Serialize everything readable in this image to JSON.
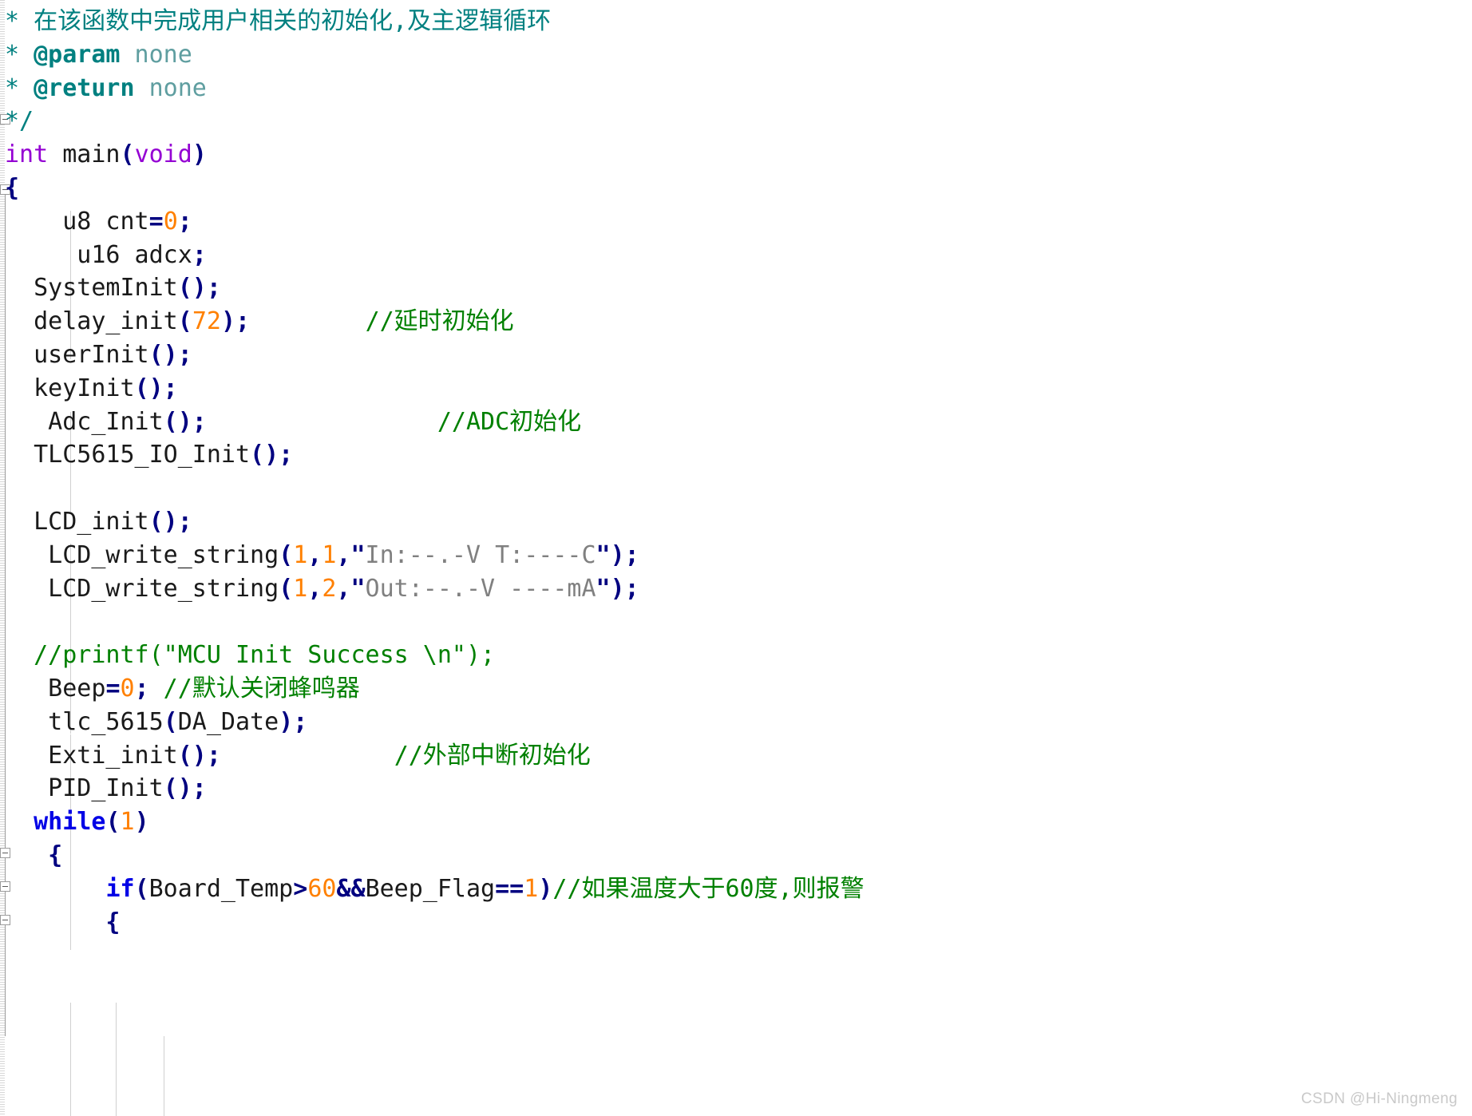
{
  "editor": {
    "language": "c",
    "watermark": "CSDN @Hi-Ningmeng",
    "colors": {
      "background": "#ffffff",
      "doc_comment": "#008080",
      "keyword_type": "#9400d3",
      "keyword_control": "#0000e6",
      "punctuation": "#000080",
      "number": "#ff8000",
      "identifier": "#1a1a1a",
      "line_comment": "#008000",
      "string": "#808080",
      "indent_guide": "#d0d0d0",
      "fold_marker": "#9a9a9a"
    }
  },
  "code": {
    "lines": [
      {
        "id": "l1",
        "tokens": [
          {
            "t": "doc",
            "v": "* "
          },
          {
            "t": "doc",
            "v": "在该函数中完成用户相关的初始化,及主逻辑循环"
          }
        ]
      },
      {
        "id": "l2",
        "tokens": [
          {
            "t": "doc",
            "v": "* "
          },
          {
            "t": "doctag",
            "v": "@param"
          },
          {
            "t": "docval",
            "v": " none"
          }
        ]
      },
      {
        "id": "l3",
        "tokens": [
          {
            "t": "doc",
            "v": "* "
          },
          {
            "t": "doctag",
            "v": "@return"
          },
          {
            "t": "docval",
            "v": " none"
          }
        ]
      },
      {
        "id": "l4",
        "tokens": [
          {
            "t": "doc",
            "v": "*/"
          }
        ]
      },
      {
        "id": "l5",
        "tokens": [
          {
            "t": "kw",
            "v": "int"
          },
          {
            "t": "id",
            "v": " main"
          },
          {
            "t": "punct",
            "v": "("
          },
          {
            "t": "kw",
            "v": "void"
          },
          {
            "t": "punct",
            "v": ")"
          }
        ]
      },
      {
        "id": "l6",
        "tokens": [
          {
            "t": "punct",
            "v": "{"
          }
        ]
      },
      {
        "id": "l7",
        "tokens": [
          {
            "t": "id",
            "v": "    u8 cnt"
          },
          {
            "t": "op",
            "v": "="
          },
          {
            "t": "num",
            "v": "0"
          },
          {
            "t": "punct",
            "v": ";"
          }
        ]
      },
      {
        "id": "l8",
        "tokens": [
          {
            "t": "id",
            "v": "     u16 adcx"
          },
          {
            "t": "punct",
            "v": ";"
          }
        ]
      },
      {
        "id": "l9",
        "tokens": [
          {
            "t": "id",
            "v": "  SystemInit"
          },
          {
            "t": "punct",
            "v": "();"
          }
        ]
      },
      {
        "id": "l10",
        "tokens": [
          {
            "t": "id",
            "v": "  delay_init"
          },
          {
            "t": "punct",
            "v": "("
          },
          {
            "t": "num",
            "v": "72"
          },
          {
            "t": "punct",
            "v": ");"
          },
          {
            "t": "id",
            "v": "        "
          },
          {
            "t": "cmt",
            "v": "//延时初始化"
          }
        ]
      },
      {
        "id": "l11",
        "tokens": [
          {
            "t": "id",
            "v": "  userInit"
          },
          {
            "t": "punct",
            "v": "();"
          }
        ]
      },
      {
        "id": "l12",
        "tokens": [
          {
            "t": "id",
            "v": "  keyInit"
          },
          {
            "t": "punct",
            "v": "();"
          }
        ]
      },
      {
        "id": "l13",
        "tokens": [
          {
            "t": "id",
            "v": "   Adc_Init"
          },
          {
            "t": "punct",
            "v": "();"
          },
          {
            "t": "id",
            "v": "                "
          },
          {
            "t": "cmt",
            "v": "//ADC初始化"
          }
        ]
      },
      {
        "id": "l14",
        "tokens": [
          {
            "t": "id",
            "v": "  TLC5615_IO_Init"
          },
          {
            "t": "punct",
            "v": "();"
          }
        ]
      },
      {
        "id": "l15",
        "tokens": []
      },
      {
        "id": "l16",
        "tokens": [
          {
            "t": "id",
            "v": "  LCD_init"
          },
          {
            "t": "punct",
            "v": "();"
          }
        ]
      },
      {
        "id": "l17",
        "tokens": [
          {
            "t": "id",
            "v": "   LCD_write_string"
          },
          {
            "t": "punct",
            "v": "("
          },
          {
            "t": "num",
            "v": "1"
          },
          {
            "t": "punct",
            "v": ","
          },
          {
            "t": "num",
            "v": "1"
          },
          {
            "t": "punct",
            "v": ","
          },
          {
            "t": "quote",
            "v": "\""
          },
          {
            "t": "str",
            "v": "In:--.-V T:----C"
          },
          {
            "t": "quote",
            "v": "\""
          },
          {
            "t": "punct",
            "v": ");"
          }
        ]
      },
      {
        "id": "l18",
        "tokens": [
          {
            "t": "id",
            "v": "   LCD_write_string"
          },
          {
            "t": "punct",
            "v": "("
          },
          {
            "t": "num",
            "v": "1"
          },
          {
            "t": "punct",
            "v": ","
          },
          {
            "t": "num",
            "v": "2"
          },
          {
            "t": "punct",
            "v": ","
          },
          {
            "t": "quote",
            "v": "\""
          },
          {
            "t": "str",
            "v": "Out:--.-V ----mA"
          },
          {
            "t": "quote",
            "v": "\""
          },
          {
            "t": "punct",
            "v": ");"
          }
        ]
      },
      {
        "id": "l19",
        "tokens": []
      },
      {
        "id": "l20",
        "tokens": [
          {
            "t": "cmt",
            "v": "  //printf(\"MCU Init Success \\n\");"
          }
        ]
      },
      {
        "id": "l21",
        "tokens": [
          {
            "t": "id",
            "v": "   Beep"
          },
          {
            "t": "op",
            "v": "="
          },
          {
            "t": "num",
            "v": "0"
          },
          {
            "t": "punct",
            "v": ";"
          },
          {
            "t": "cmt",
            "v": " //默认关闭蜂鸣器"
          }
        ]
      },
      {
        "id": "l22",
        "tokens": [
          {
            "t": "id",
            "v": "   tlc_5615"
          },
          {
            "t": "punct",
            "v": "("
          },
          {
            "t": "id",
            "v": "DA_Date"
          },
          {
            "t": "punct",
            "v": ");"
          }
        ]
      },
      {
        "id": "l23",
        "tokens": [
          {
            "t": "id",
            "v": "   Exti_init"
          },
          {
            "t": "punct",
            "v": "();"
          },
          {
            "t": "id",
            "v": "            "
          },
          {
            "t": "cmt",
            "v": "//外部中断初始化"
          }
        ]
      },
      {
        "id": "l24",
        "tokens": [
          {
            "t": "id",
            "v": "   PID_Init"
          },
          {
            "t": "punct",
            "v": "();"
          }
        ]
      },
      {
        "id": "l25",
        "tokens": [
          {
            "t": "id",
            "v": "  "
          },
          {
            "t": "kwb",
            "v": "while"
          },
          {
            "t": "punct",
            "v": "("
          },
          {
            "t": "num",
            "v": "1"
          },
          {
            "t": "punct",
            "v": ")"
          }
        ]
      },
      {
        "id": "l26",
        "tokens": [
          {
            "t": "punct",
            "v": "   {"
          }
        ]
      },
      {
        "id": "l27",
        "tokens": [
          {
            "t": "id",
            "v": "       "
          },
          {
            "t": "kwb",
            "v": "if"
          },
          {
            "t": "punct",
            "v": "("
          },
          {
            "t": "id",
            "v": "Board_Temp"
          },
          {
            "t": "op",
            "v": ">"
          },
          {
            "t": "num",
            "v": "60"
          },
          {
            "t": "op",
            "v": "&&"
          },
          {
            "t": "id",
            "v": "Beep_Flag"
          },
          {
            "t": "op",
            "v": "=="
          },
          {
            "t": "num",
            "v": "1"
          },
          {
            "t": "punct",
            "v": ")"
          },
          {
            "t": "cmt",
            "v": "//如果温度大于60度,则报警"
          }
        ]
      },
      {
        "id": "l28",
        "tokens": [
          {
            "t": "punct",
            "v": "       {"
          }
        ]
      }
    ]
  }
}
